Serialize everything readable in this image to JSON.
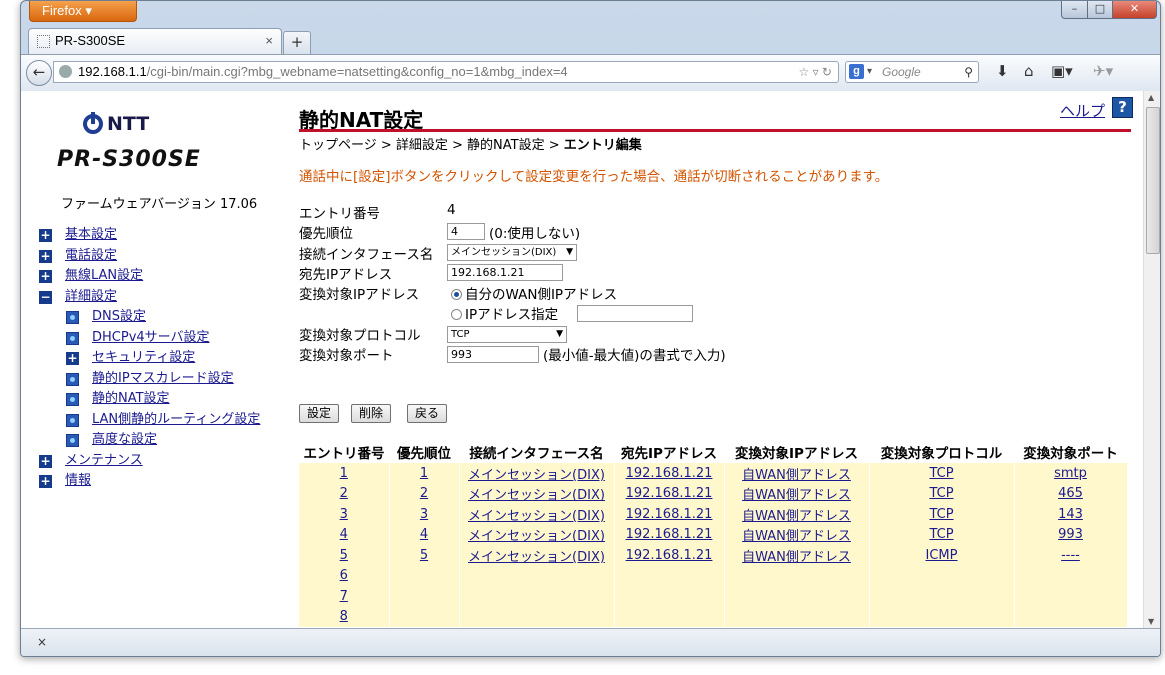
{
  "browser": {
    "app_button": "Firefox ▾",
    "tab_title": "PR-S300SE",
    "new_tab": "+",
    "url_host": "192.168.1.1",
    "url_path": "/cgi-bin/main.cgi?mbg_webname=natsetting&config_no=1&mbg_index=4",
    "search_placeholder": "Google",
    "window_controls": {
      "minimize": "–",
      "maximize": "□",
      "close": "✕"
    },
    "status_close": "×"
  },
  "sidebar": {
    "brand": "NTT",
    "model": "PR-S300SE",
    "firmware": "ファームウェアバージョン 17.06",
    "items": [
      {
        "label": "基本設定",
        "icon": "plus-icon",
        "level": 0
      },
      {
        "label": "電話設定",
        "icon": "plus-icon",
        "level": 0
      },
      {
        "label": "無線LAN設定",
        "icon": "plus-icon",
        "level": 0
      },
      {
        "label": "詳細設定",
        "icon": "minus-icon",
        "level": 0
      },
      {
        "label": "DNS設定",
        "icon": "page-icon",
        "level": 1
      },
      {
        "label": "DHCPv4サーバ設定",
        "icon": "page-icon",
        "level": 1
      },
      {
        "label": "セキュリティ設定",
        "icon": "plus-icon",
        "level": 1
      },
      {
        "label": "静的IPマスカレード設定",
        "icon": "page-icon",
        "level": 1
      },
      {
        "label": "静的NAT設定",
        "icon": "page-icon",
        "level": 1
      },
      {
        "label": "LAN側静的ルーティング設定",
        "icon": "page-icon",
        "level": 1
      },
      {
        "label": "高度な設定",
        "icon": "page-icon",
        "level": 1
      },
      {
        "label": "メンテナンス",
        "icon": "plus-icon",
        "level": 0
      },
      {
        "label": "情報",
        "icon": "plus-icon",
        "level": 0
      }
    ]
  },
  "main": {
    "title": "静的NAT設定",
    "breadcrumb": "トップページ > 詳細設定 > 静的NAT設定 > ",
    "breadcrumb_current": "エントリ編集",
    "help": "ヘルプ",
    "help_icon": "?",
    "warning": "通話中に[設定]ボタンをクリックして設定変更を行った場合、通話が切断されることがあります。",
    "form": {
      "entry_label": "エントリ番号",
      "entry_value": "4",
      "priority_label": "優先順位",
      "priority_value": "4",
      "priority_note": "(0:使用しない)",
      "interface_label": "接続インタフェース名",
      "interface_value": "メインセッション(DIX)",
      "dest_ip_label": "宛先IPアドレス",
      "dest_ip_value": "192.168.1.21",
      "trans_ip_label": "変換対象IPアドレス",
      "trans_ip_option1": "自分のWAN側IPアドレス",
      "trans_ip_option2": "IPアドレス指定",
      "trans_ip_custom": "",
      "protocol_label": "変換対象プロトコル",
      "protocol_value": "TCP",
      "port_label": "変換対象ポート",
      "port_value": "993",
      "port_note": "(最小値-最大値)の書式で入力)"
    },
    "buttons": {
      "save": "設定",
      "delete": "削除",
      "back": "戻る"
    },
    "table": {
      "headers": [
        "エントリ番号",
        "優先順位",
        "接続インタフェース名",
        "宛先IPアドレス",
        "変換対象IPアドレス",
        "変換対象プロトコル",
        "変換対象ポート"
      ],
      "rows": [
        [
          "1",
          "1",
          "メインセッション(DIX)",
          "192.168.1.21",
          "自WAN側アドレス",
          "TCP",
          "smtp"
        ],
        [
          "2",
          "2",
          "メインセッション(DIX)",
          "192.168.1.21",
          "自WAN側アドレス",
          "TCP",
          "465"
        ],
        [
          "3",
          "3",
          "メインセッション(DIX)",
          "192.168.1.21",
          "自WAN側アドレス",
          "TCP",
          "143"
        ],
        [
          "4",
          "4",
          "メインセッション(DIX)",
          "192.168.1.21",
          "自WAN側アドレス",
          "TCP",
          "993"
        ],
        [
          "5",
          "5",
          "メインセッション(DIX)",
          "192.168.1.21",
          "自WAN側アドレス",
          "ICMP",
          "----"
        ],
        [
          "6",
          "",
          "",
          "",
          "",
          "",
          ""
        ],
        [
          "7",
          "",
          "",
          "",
          "",
          "",
          ""
        ],
        [
          "8",
          "",
          "",
          "",
          "",
          "",
          ""
        ]
      ]
    }
  }
}
